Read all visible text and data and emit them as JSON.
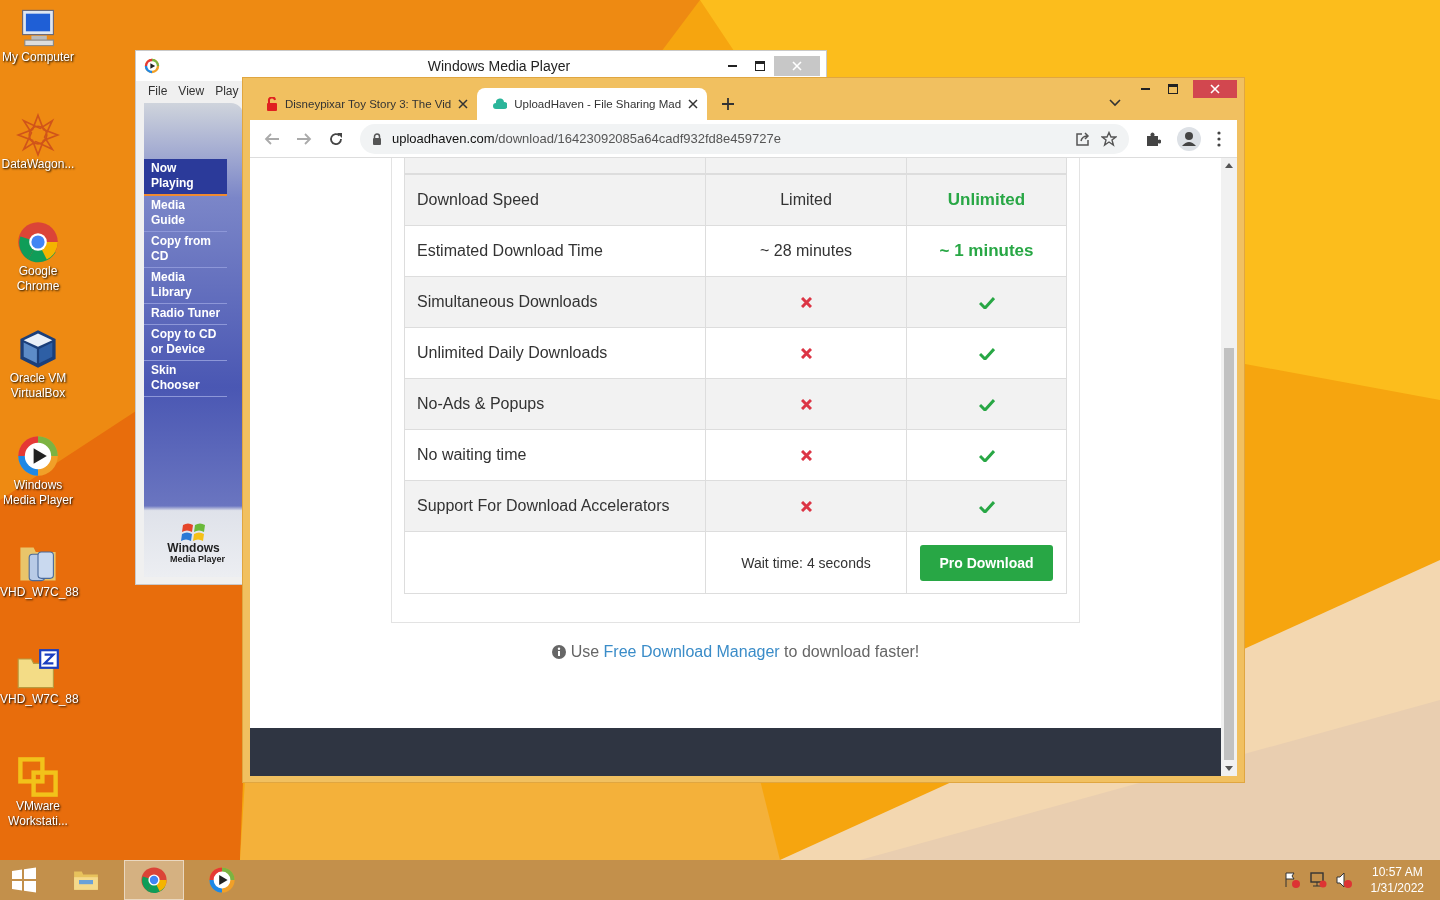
{
  "desktop_icons": [
    {
      "kind": "computer",
      "label": "My Computer"
    },
    {
      "kind": "mandala",
      "label": "DataWagon..."
    },
    {
      "kind": "chrome",
      "label": "Google Chrome"
    },
    {
      "kind": "cube",
      "label": "Oracle VM VirtualBox"
    },
    {
      "kind": "player",
      "label": "Windows Media Player"
    },
    {
      "kind": "music-folder",
      "label": "VHD_W7C_88"
    },
    {
      "kind": "zip-folder",
      "label": "VHD_W7C_88"
    },
    {
      "kind": "vmware",
      "label": "VMware Workstati..."
    }
  ],
  "media_player": {
    "title": "Windows Media Player",
    "menu": [
      "File",
      "View",
      "Play"
    ],
    "nav": [
      {
        "label": "Now Playing",
        "selected": true
      },
      {
        "label": "Media Guide",
        "selected": false
      },
      {
        "label": "Copy from CD",
        "selected": false
      },
      {
        "label": "Media Library",
        "selected": false
      },
      {
        "label": "Radio Tuner",
        "selected": false
      },
      {
        "label": "Copy to CD or Device",
        "selected": false
      },
      {
        "label": "Skin Chooser",
        "selected": false
      }
    ],
    "logo_text": [
      "Windows",
      "Media Player"
    ]
  },
  "browser": {
    "tabs": [
      {
        "title": "Disneypixar Toy Story 3: The Vid",
        "selected": false
      },
      {
        "title": "UploadHaven - File Sharing Mad",
        "selected": true
      }
    ],
    "url_host": "uploadhaven.com",
    "url_path": "/download/16423092085a64cadf932fd8e459727e",
    "rows": [
      {
        "kind": "text",
        "feature": "Download Speed",
        "free": "Limited",
        "pro": "Unlimited"
      },
      {
        "kind": "text",
        "feature": "Estimated Download Time",
        "free": "~ 28 minutes",
        "pro": "~ 1 minutes"
      },
      {
        "kind": "check",
        "feature": "Simultaneous Downloads",
        "free": false,
        "pro": true
      },
      {
        "kind": "check",
        "feature": "Unlimited Daily Downloads",
        "free": false,
        "pro": true
      },
      {
        "kind": "check",
        "feature": "No-Ads & Popups",
        "free": false,
        "pro": true
      },
      {
        "kind": "check",
        "feature": "No waiting time",
        "free": false,
        "pro": true
      },
      {
        "kind": "check",
        "feature": "Support For Download Accelerators",
        "free": false,
        "pro": true
      }
    ],
    "wait_text": "Wait time: 4 seconds",
    "pro_button": "Pro Download",
    "notice": {
      "before": "Use",
      "link": "Free Download Manager",
      "after": "to download faster!"
    }
  },
  "taskbar": {
    "apps": [
      {
        "kind": "explorer",
        "selected": false
      },
      {
        "kind": "chrome",
        "selected": true
      },
      {
        "kind": "player",
        "selected": false
      }
    ],
    "time": "10:57 AM",
    "date": "1/31/2022"
  }
}
